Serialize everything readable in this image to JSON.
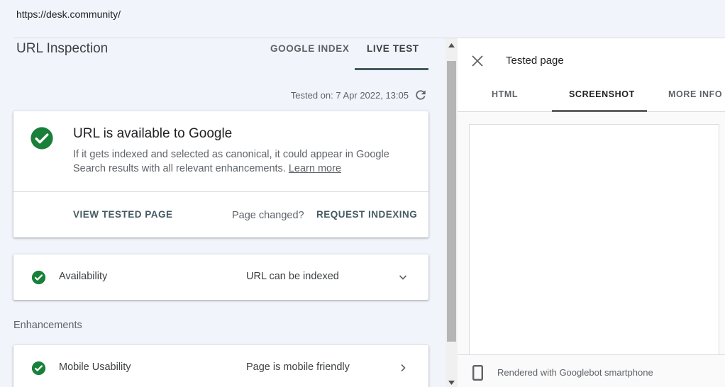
{
  "url": "https://desk.community/",
  "left": {
    "page_title": "URL Inspection",
    "tabs": [
      {
        "label": "GOOGLE INDEX",
        "active": false
      },
      {
        "label": "LIVE TEST",
        "active": true
      }
    ],
    "tested_on": "Tested on: 7 Apr 2022, 13:05",
    "main_card": {
      "status_icon": "check-circle-icon",
      "title": "URL is available to Google",
      "description": "If it gets indexed and selected as canonical, it could appear in Google Search results with all relevant enhancements.",
      "learn_more": "Learn more",
      "view_tested_page": "VIEW TESTED PAGE",
      "page_changed": "Page changed?",
      "request_indexing": "REQUEST INDEXING"
    },
    "availability": {
      "label": "Availability",
      "value": "URL can be indexed",
      "chevron": "chevron-down-icon"
    },
    "enhancements_label": "Enhancements",
    "mobile_usability": {
      "label": "Mobile Usability",
      "value": "Page is mobile friendly",
      "chevron": "chevron-right-icon"
    }
  },
  "right": {
    "title": "Tested page",
    "tabs": [
      {
        "label": "HTML",
        "active": false
      },
      {
        "label": "SCREENSHOT",
        "active": true
      },
      {
        "label": "MORE INFO",
        "active": false
      }
    ],
    "footer_text": "Rendered with Googlebot smartphone"
  },
  "colors": {
    "success_green": "#188038",
    "accent_slate": "#455a64",
    "background": "#f1f4fa"
  }
}
